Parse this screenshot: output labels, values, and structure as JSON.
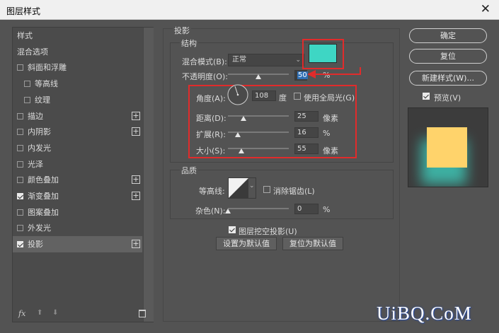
{
  "window": {
    "title": "图层样式",
    "close_glyph": "✕"
  },
  "left_panel": {
    "items": [
      {
        "label": "样式",
        "checkbox": false,
        "checked": false,
        "plus": false,
        "indent": 0
      },
      {
        "label": "混合选项",
        "checkbox": false,
        "checked": false,
        "plus": false,
        "indent": 0
      },
      {
        "label": "斜面和浮雕",
        "checkbox": true,
        "checked": false,
        "plus": false,
        "indent": 0
      },
      {
        "label": "等高线",
        "checkbox": true,
        "checked": false,
        "plus": false,
        "indent": 1
      },
      {
        "label": "纹理",
        "checkbox": true,
        "checked": false,
        "plus": false,
        "indent": 1
      },
      {
        "label": "描边",
        "checkbox": true,
        "checked": false,
        "plus": true,
        "indent": 0
      },
      {
        "label": "内阴影",
        "checkbox": true,
        "checked": false,
        "plus": true,
        "indent": 0
      },
      {
        "label": "内发光",
        "checkbox": true,
        "checked": false,
        "plus": false,
        "indent": 0
      },
      {
        "label": "光泽",
        "checkbox": true,
        "checked": false,
        "plus": false,
        "indent": 0
      },
      {
        "label": "颜色叠加",
        "checkbox": true,
        "checked": false,
        "plus": true,
        "indent": 0
      },
      {
        "label": "渐变叠加",
        "checkbox": true,
        "checked": true,
        "plus": true,
        "indent": 0
      },
      {
        "label": "图案叠加",
        "checkbox": true,
        "checked": false,
        "plus": false,
        "indent": 0
      },
      {
        "label": "外发光",
        "checkbox": true,
        "checked": false,
        "plus": false,
        "indent": 0
      },
      {
        "label": "投影",
        "checkbox": true,
        "checked": true,
        "plus": true,
        "indent": 0,
        "active": true
      }
    ],
    "bottom": {
      "fx": "fx",
      "up": "⬆",
      "down": "⬇",
      "trash": "🗑"
    }
  },
  "drop_shadow": {
    "section_title": "投影",
    "structure_title": "结构",
    "blend_mode_label": "混合模式(B):",
    "blend_mode_value": "正常",
    "shadow_color": "#3ed6c4",
    "opacity_label": "不透明度(O):",
    "opacity_value": "50",
    "opacity_unit": "%",
    "opacity_level": 0.5,
    "angle_label": "角度(A):",
    "angle_value": "108",
    "angle_unit": "度",
    "global_light_label": "使用全局光(G)",
    "global_light_checked": false,
    "distance_label": "距离(D):",
    "distance_value": "25",
    "distance_unit": "像素",
    "distance_level": 0.25,
    "spread_label": "扩展(R):",
    "spread_value": "16",
    "spread_unit": "%",
    "spread_level": 0.16,
    "size_label": "大小(S):",
    "size_value": "55",
    "size_unit": "像素",
    "size_level": 0.22,
    "quality_title": "品质",
    "contour_label": "等高线:",
    "antialias_label": "消除锯齿(L)",
    "antialias_checked": false,
    "noise_label": "杂色(N):",
    "noise_value": "0",
    "noise_unit": "%",
    "noise_level": 0,
    "knockout_label": "图层挖空投影(U)",
    "knockout_checked": true,
    "set_default_label": "设置为默认值",
    "reset_default_label": "复位为默认值"
  },
  "right_panel": {
    "ok_label": "确定",
    "reset_label": "复位",
    "new_style_label": "新建样式(W)...",
    "preview_label": "预览(V)",
    "preview_checked": true,
    "preview_fill": "#ffd36b",
    "preview_shadow": "#3ed6c4"
  },
  "watermark": "UiBQ.CoM",
  "colors": {
    "highlight_red": "#e12b2b",
    "accent_blue": "#2f6fb4"
  }
}
